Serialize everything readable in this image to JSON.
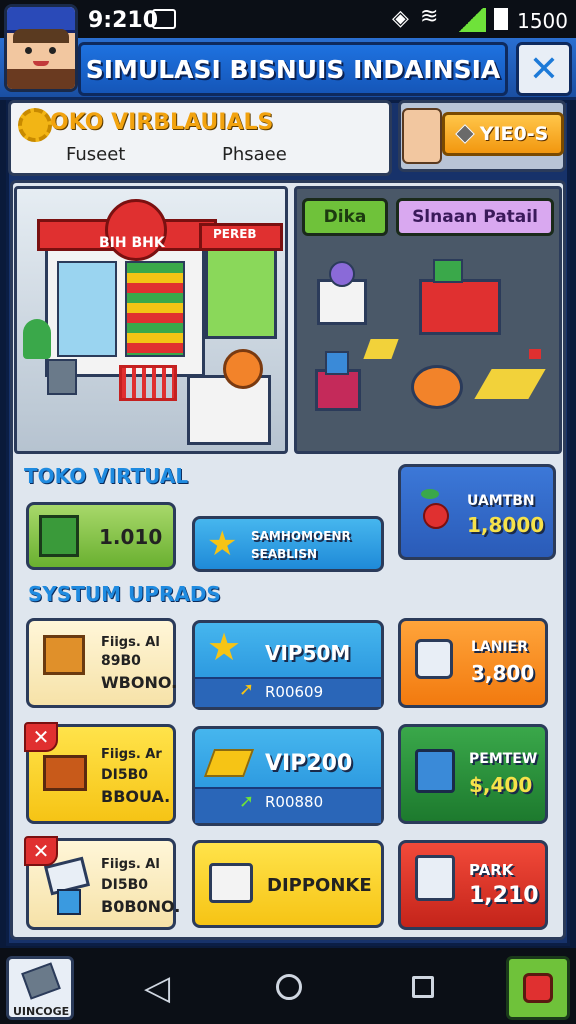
{
  "status": {
    "time": "9:210",
    "battery": "1500"
  },
  "header": {
    "title": "SIMULASI BISNUIS INDAINSIA",
    "close": "✕"
  },
  "info": {
    "title": "OKO VIRBLAUIALS",
    "sub1": "Fuseet",
    "sub2": "Phsaee"
  },
  "coins": {
    "value": "YIE0-S"
  },
  "scene_left": {
    "sign": "BIH BHK",
    "sign2": "PEREB"
  },
  "scene_right": {
    "btn1": "Dika",
    "btn2": "Slnaan Patail"
  },
  "section1": {
    "title": "TOKO VIRTUAL",
    "tile1": {
      "value": "1.010"
    },
    "tile2": {
      "line1": "SAMHOMOENR",
      "line2": "SEABLISN"
    },
    "tile3": {
      "label": "UAMTBN",
      "value": "1,8000"
    }
  },
  "section2": {
    "title": "SYSTUM UPRADS",
    "rows": [
      {
        "left": {
          "l1": "Fiigs. Al",
          "l2": "89B0",
          "l3": "WBONO."
        },
        "mid": {
          "top": "VIP50M",
          "bottom": "R00609"
        },
        "right": {
          "label": "LANIER",
          "value": "3,800"
        }
      },
      {
        "left": {
          "l1": "Fiigs. Ar",
          "l2": "DI5B0",
          "l3": "BBOUA."
        },
        "mid": {
          "top": "VIP200",
          "bottom": "R00880"
        },
        "right": {
          "label": "PEMTEW",
          "value": "$,400"
        }
      },
      {
        "left": {
          "l1": "Fiigs. Al",
          "l2": "DI5B0",
          "l3": "B0B0NO."
        },
        "mid": {
          "top": "DIPPONKE",
          "bottom": ""
        },
        "right": {
          "label": "PARK",
          "value": "1,210"
        }
      }
    ]
  },
  "nav": {
    "left_label": "UINCOGE"
  }
}
